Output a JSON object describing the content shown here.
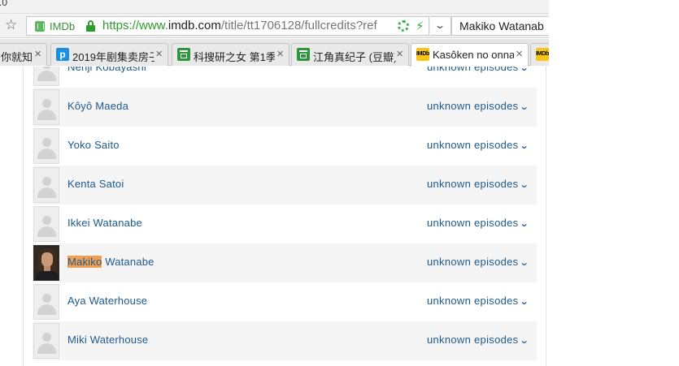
{
  "browser": {
    "version_fragment": ".0",
    "site_label": "IMDb",
    "url_scheme": "https://www.",
    "url_host": "imdb.com",
    "url_path": "/title/tt1706128/fullcredits?ref",
    "search_text": "Makiko Watanab",
    "dropdown_glyph": "⌄",
    "bookmark_glyph": "☆",
    "ext_bolt_glyph": "⚡"
  },
  "tabs": [
    {
      "title": "你就知",
      "favicon": "none"
    },
    {
      "title": "2019年剧集卖房子",
      "favicon": "p-icon",
      "favicon_text": "p"
    },
    {
      "title": "科搜研之女 第1季",
      "favicon": "douban-icon"
    },
    {
      "title": "江角真纪子 (豆瓣)",
      "favicon": "douban-icon"
    },
    {
      "title": "Kasôken no onna",
      "favicon": "imdb-icon",
      "favicon_text": "IMDb",
      "active": true
    },
    {
      "title": "",
      "favicon": "imdb-icon",
      "favicon_text": "IMDb"
    }
  ],
  "tab_close_glyph": "×",
  "episodes_icon_glyph": "⌄",
  "cast_rows": [
    {
      "first": "Nenji",
      "last": "Kobayashi",
      "episodes": "unknown episodes",
      "photo": false
    },
    {
      "first": "Kôyô",
      "last": "Maeda",
      "episodes": "unknown episodes",
      "photo": false
    },
    {
      "first": "Yoko",
      "last": "Saito",
      "episodes": "unknown episodes",
      "photo": false
    },
    {
      "first": "Kenta",
      "last": "Satoi",
      "episodes": "unknown episodes",
      "photo": false
    },
    {
      "first": "Ikkei",
      "last": "Watanabe",
      "episodes": "unknown episodes",
      "photo": false
    },
    {
      "first": "Makiko",
      "last": "Watanabe",
      "episodes": "unknown episodes",
      "photo": true,
      "highlight_first": true
    },
    {
      "first": "Aya",
      "last": "Waterhouse",
      "episodes": "unknown episodes",
      "photo": false
    },
    {
      "first": "Miki",
      "last": "Waterhouse",
      "episodes": "unknown episodes",
      "photo": false
    }
  ],
  "colors": {
    "link": "#1b5a90",
    "highlight": "#f0a050",
    "secure_green": "#2d9a2d"
  }
}
